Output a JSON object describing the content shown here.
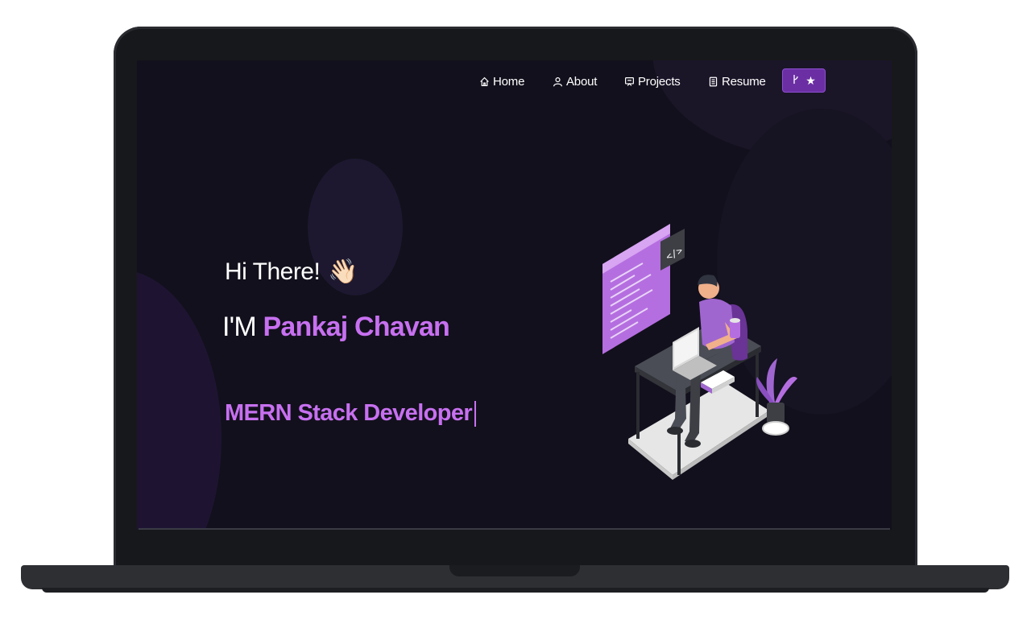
{
  "nav": {
    "items": [
      {
        "label": "Home",
        "icon": "home-icon"
      },
      {
        "label": "About",
        "icon": "user-icon"
      },
      {
        "label": "Projects",
        "icon": "projects-icon"
      },
      {
        "label": "Resume",
        "icon": "document-icon"
      }
    ],
    "github_button": {
      "icons": [
        "git-fork-icon",
        "star-icon"
      ]
    }
  },
  "hero": {
    "greeting": "Hi There!",
    "wave_emoji": "👋🏻",
    "intro_prefix": "I'M",
    "name": "Pankaj Chavan",
    "typewriter_text": "MERN Stack Developer"
  },
  "colors": {
    "accent": "#c770f0",
    "button": "#6b2fa3",
    "background": "#12101c"
  }
}
